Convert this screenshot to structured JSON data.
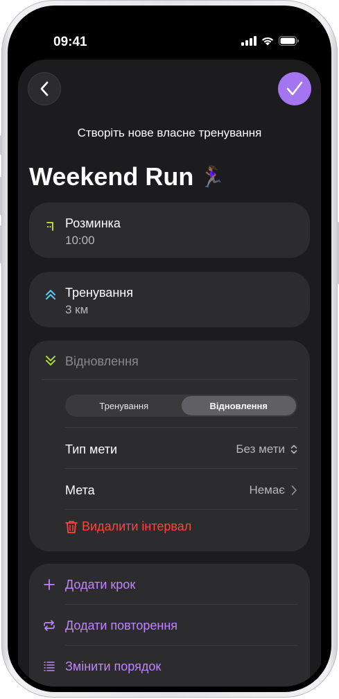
{
  "status_bar": {
    "time": "09:41"
  },
  "header": {
    "title": "Створіть нове власне тренування"
  },
  "workout": {
    "name": "Weekend Run",
    "emoji": "🏃🏾‍♀️"
  },
  "steps": [
    {
      "title": "Розминка",
      "subtitle": "10:00",
      "icon": "warmup-icon",
      "color": "#d6e83a"
    },
    {
      "title": "Тренування",
      "subtitle": "3 км",
      "icon": "double-chevron-up-icon",
      "color": "#5ac8fa"
    },
    {
      "title": "Відновлення",
      "icon": "double-chevron-down-icon",
      "color": "#a7d93b"
    }
  ],
  "segment": {
    "options": [
      "Тренування",
      "Відновлення"
    ],
    "selected": "Відновлення"
  },
  "goal_type": {
    "label": "Тип мети",
    "value": "Без мети"
  },
  "goal": {
    "label": "Мета",
    "value": "Немає"
  },
  "delete_interval": {
    "label": "Видалити інтервал"
  },
  "actions": [
    {
      "label": "Додати крок",
      "icon": "plus-icon"
    },
    {
      "label": "Додати повторення",
      "icon": "repeat-icon"
    },
    {
      "label": "Змінити порядок",
      "icon": "list-reorder-icon"
    }
  ],
  "colors": {
    "accent": "#a475f0",
    "action": "#c084fc",
    "destructive": "#ff453a"
  }
}
